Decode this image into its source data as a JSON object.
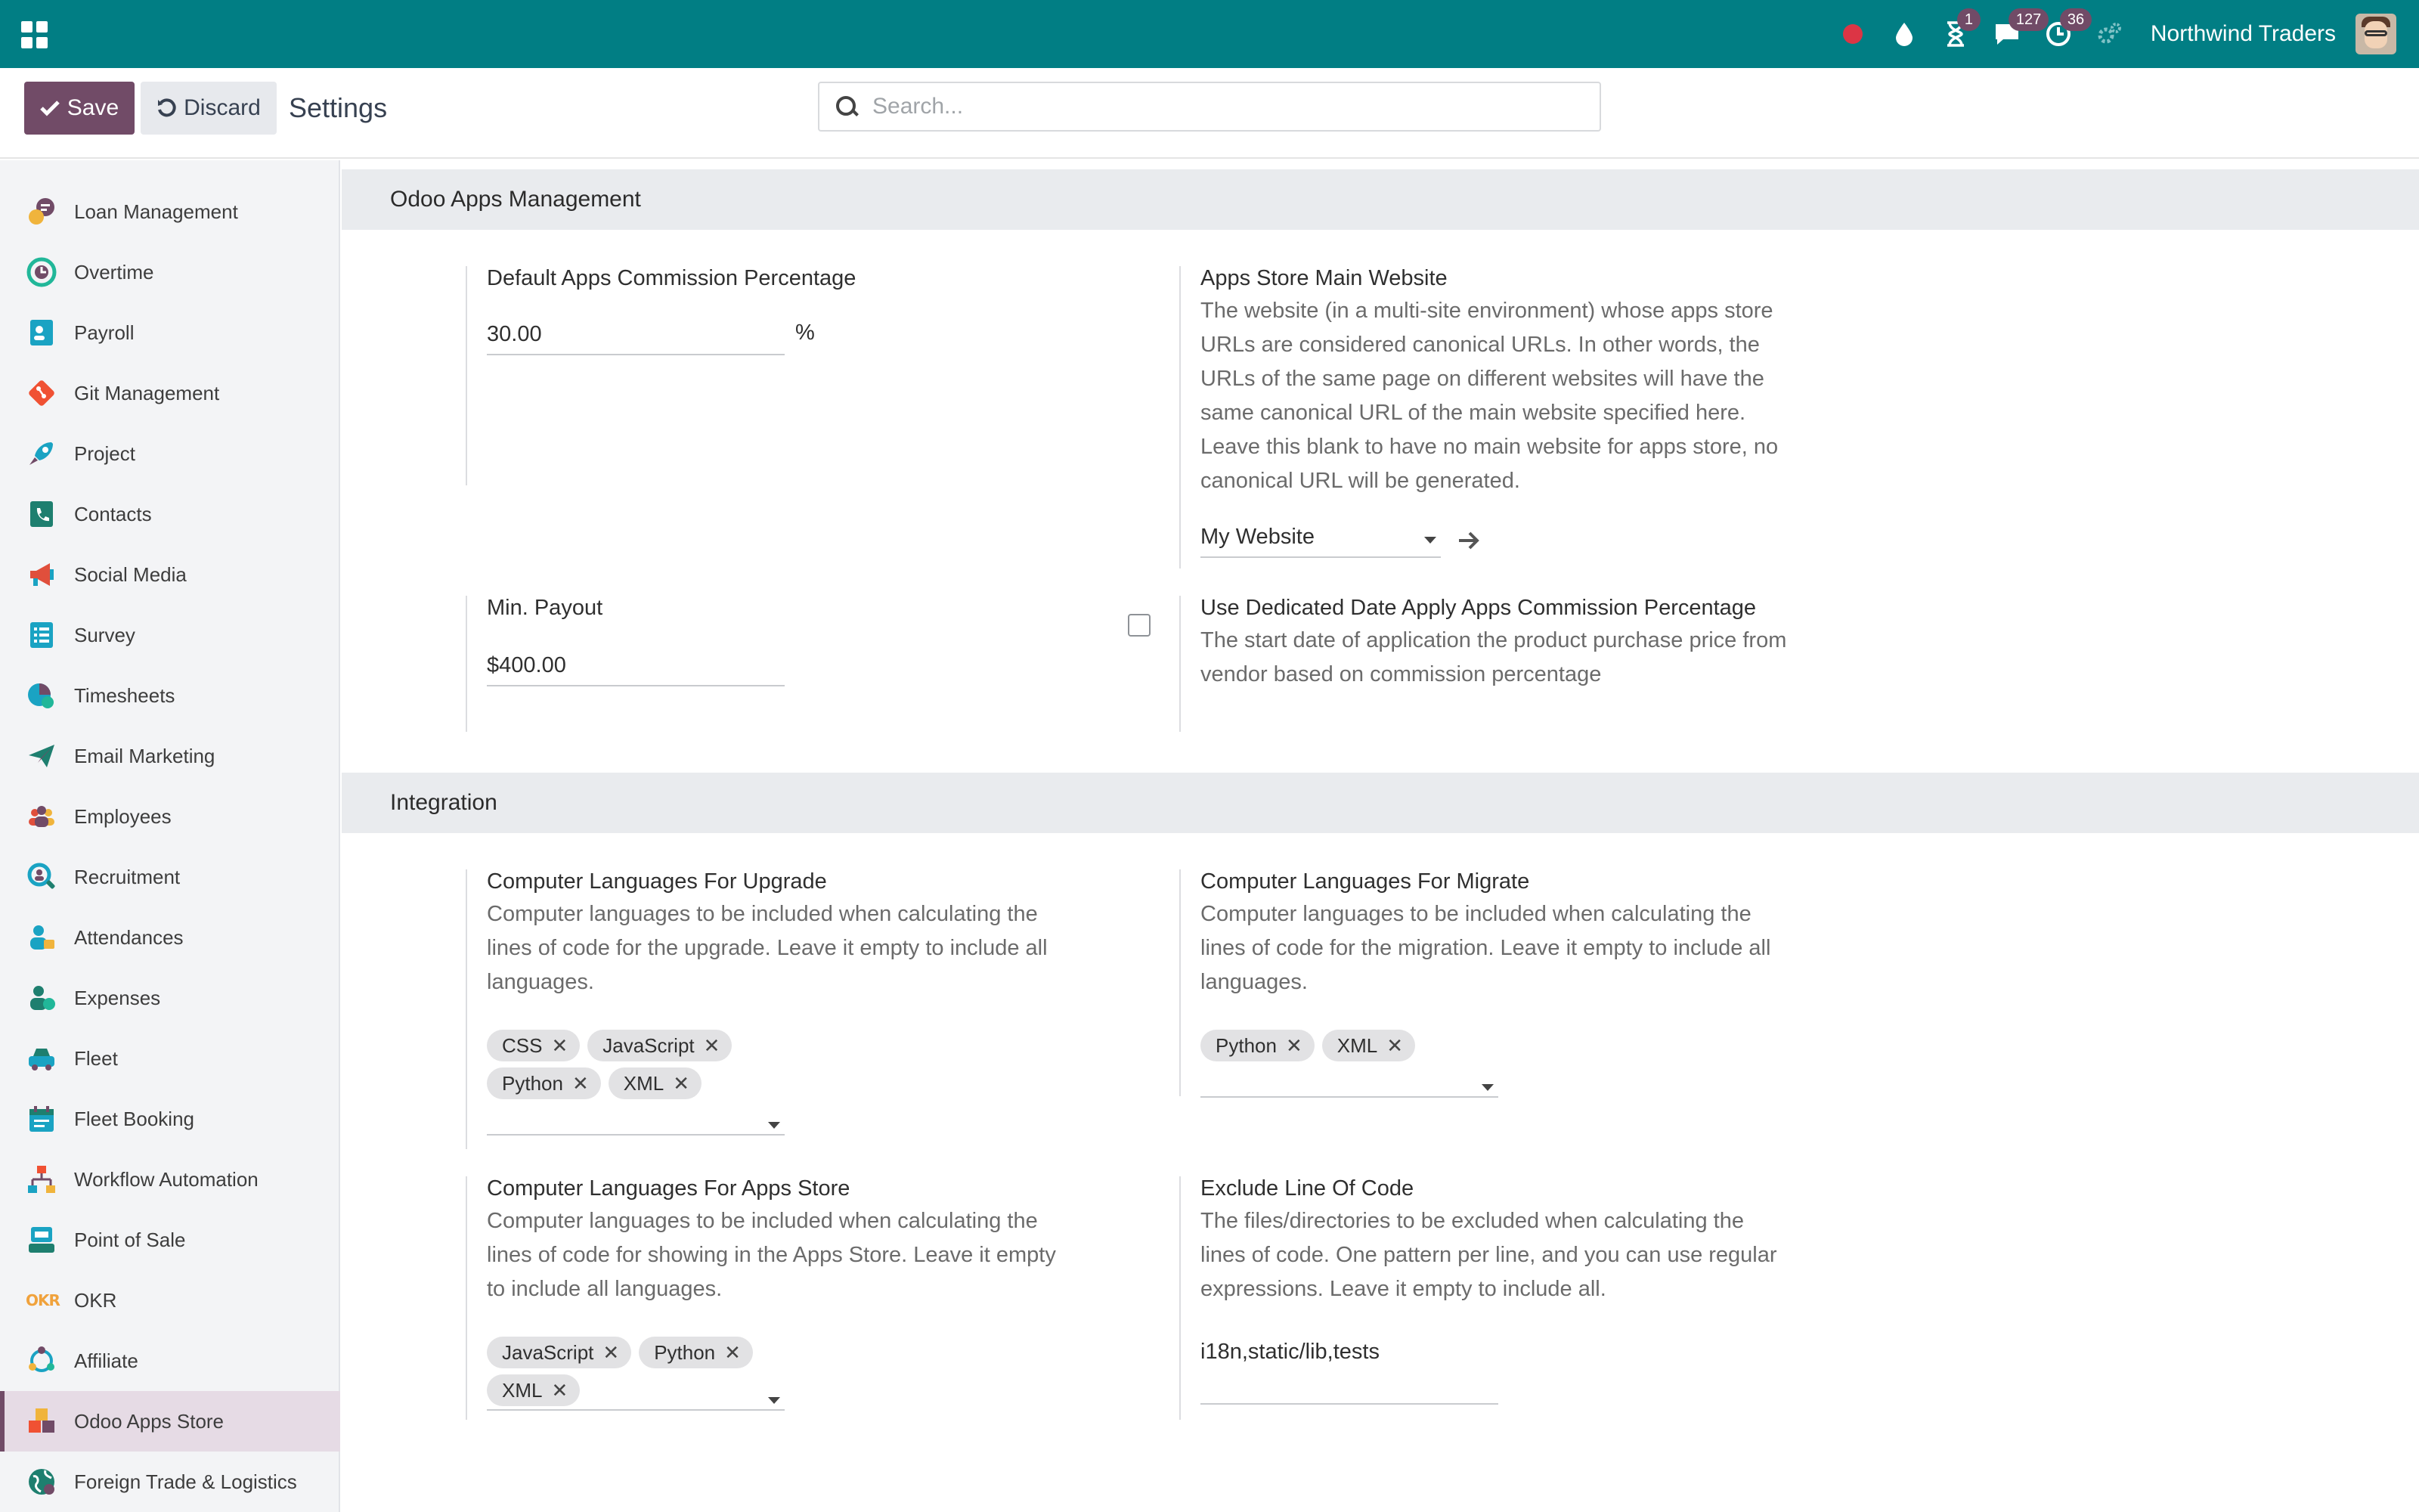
{
  "navbar": {
    "company": "Northwind Traders",
    "activities_count": "1",
    "messages_count": "127",
    "timer_count": "36"
  },
  "control": {
    "save_label": "Save",
    "discard_label": "Discard",
    "title": "Settings",
    "search_placeholder": "Search..."
  },
  "sidebar": {
    "items": [
      {
        "label": "Loan Management"
      },
      {
        "label": "Overtime"
      },
      {
        "label": "Payroll"
      },
      {
        "label": "Git Management"
      },
      {
        "label": "Project"
      },
      {
        "label": "Contacts"
      },
      {
        "label": "Social Media"
      },
      {
        "label": "Survey"
      },
      {
        "label": "Timesheets"
      },
      {
        "label": "Email Marketing"
      },
      {
        "label": "Employees"
      },
      {
        "label": "Recruitment"
      },
      {
        "label": "Attendances"
      },
      {
        "label": "Expenses"
      },
      {
        "label": "Fleet"
      },
      {
        "label": "Fleet Booking"
      },
      {
        "label": "Workflow Automation"
      },
      {
        "label": "Point of Sale"
      },
      {
        "label": "OKR"
      },
      {
        "label": "Affiliate"
      },
      {
        "label": "Odoo Apps Store"
      },
      {
        "label": "Foreign Trade & Logistics"
      }
    ],
    "active_index": 20,
    "okr_text": "OKR"
  },
  "sections": {
    "apps_management": {
      "title": "Odoo Apps Management",
      "commission": {
        "title": "Default Apps Commission Percentage",
        "value": "30.00",
        "unit": "%"
      },
      "main_website": {
        "title": "Apps Store Main Website",
        "desc": "The website (in a multi-site environment) whose apps store URLs are considered canonical URLs. In other words, the URLs of the same page on different websites will have the same canonical URL of the main website specified here. Leave this blank to have no main website for apps store, no canonical URL will be generated.",
        "value": "My Website"
      },
      "min_payout": {
        "title": "Min. Payout",
        "value": "$400.00"
      },
      "dedicated_date": {
        "title": "Use Dedicated Date Apply Apps Commission Percentage",
        "desc": "The start date of application the product purchase price from vendor based on commission percentage",
        "checked": false
      }
    },
    "integration": {
      "title": "Integration",
      "upgrade": {
        "title": "Computer Languages For Upgrade",
        "desc": "Computer languages to be included when calculating the lines of code for the upgrade. Leave it empty to include all languages.",
        "tags": [
          "CSS",
          "JavaScript",
          "Python",
          "XML"
        ]
      },
      "migrate": {
        "title": "Computer Languages For Migrate",
        "desc": "Computer languages to be included when calculating the lines of code for the migration. Leave it empty to include all languages.",
        "tags": [
          "Python",
          "XML"
        ]
      },
      "apps_store": {
        "title": "Computer Languages For Apps Store",
        "desc": "Computer languages to be included when calculating the lines of code for showing in the Apps Store. Leave it empty to include all languages.",
        "tags": [
          "JavaScript",
          "Python",
          "XML"
        ]
      },
      "exclude": {
        "title": "Exclude Line Of Code",
        "desc": "The files/directories to be excluded when calculating the lines of code. One pattern per line, and you can use regular expressions. Leave it empty to include all.",
        "value": "i18n,static/lib,tests"
      }
    }
  },
  "tag_remove_glyph": "✕"
}
